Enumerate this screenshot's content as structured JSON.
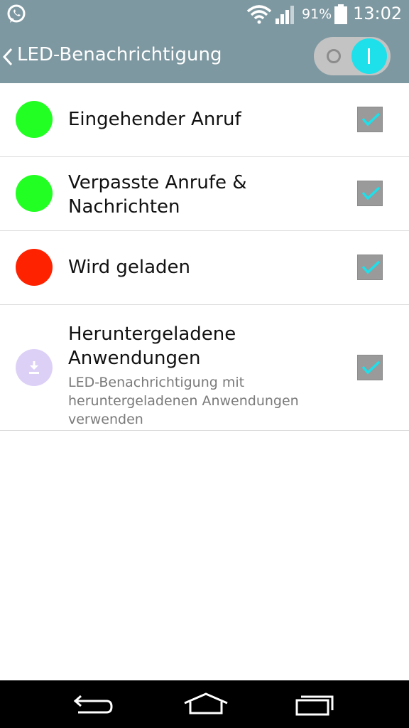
{
  "status_bar": {
    "battery_percent": "91%",
    "time": "13:02",
    "icons": [
      "whatsapp-icon",
      "wifi-icon",
      "signal-icon",
      "battery-icon"
    ]
  },
  "action_bar": {
    "title": "LED-Benachrichtigung",
    "toggle_on": true
  },
  "items": [
    {
      "label": "Eingehender Anruf",
      "color": "#22ff22",
      "checked": true
    },
    {
      "label_line1": "Verpasste Anrufe &",
      "label_line2": "Nachrichten",
      "color": "#22ff22",
      "checked": true
    },
    {
      "label": "Wird geladen",
      "color": "#ff2200",
      "checked": true
    },
    {
      "label_line1": "Heruntergeladene",
      "label_line2": "Anwendungen",
      "sub_line1": "LED-Benachrichtigung mit",
      "sub_line2": "heruntergeladenen Anwendungen",
      "sub_line3": "verwenden",
      "icon": "download-icon",
      "checked": true
    }
  ],
  "colors": {
    "bar": "#7e98a1",
    "accent": "#1de0ea",
    "checkbox": "#9a9a9a"
  },
  "nav_bar": {
    "icons": [
      "back-icon",
      "home-icon",
      "recent-apps-icon"
    ]
  }
}
